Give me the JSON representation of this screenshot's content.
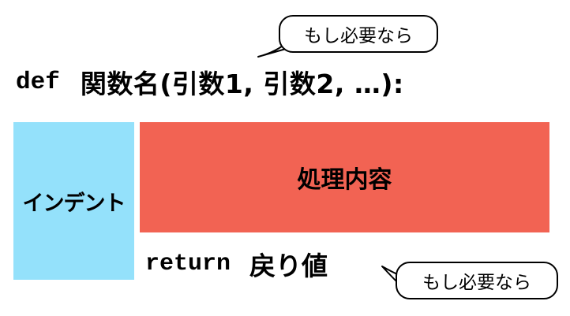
{
  "definition": {
    "keyword": "def",
    "signature": "関数名(引数1, 引数2, …):"
  },
  "indent": {
    "label": "インデント",
    "color": "#94e1fb"
  },
  "process": {
    "label": "処理内容",
    "color": "#f26353"
  },
  "return_line": {
    "keyword": "return",
    "value": "戻り値"
  },
  "callouts": {
    "arguments_note": "もし必要なら",
    "return_note": "もし必要なら"
  }
}
